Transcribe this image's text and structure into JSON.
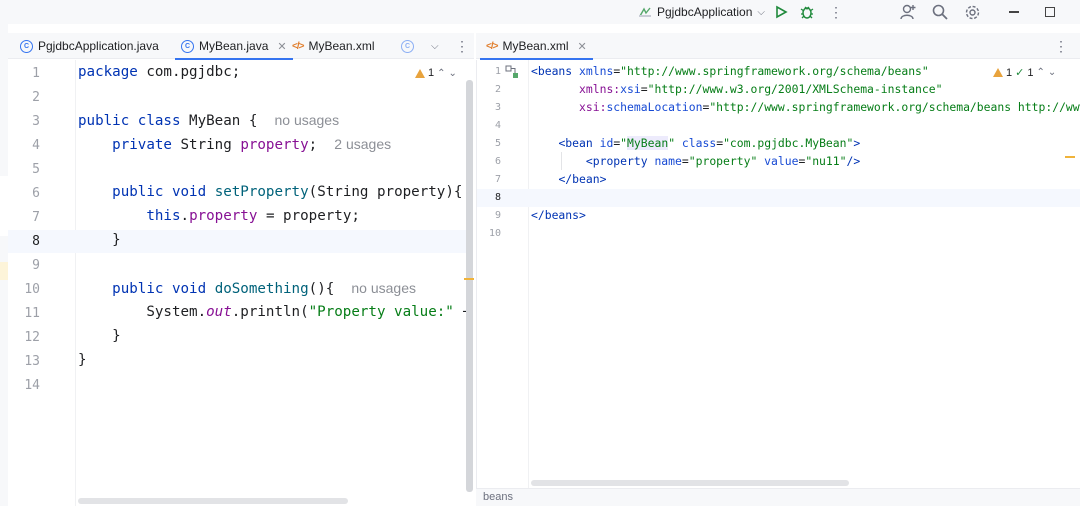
{
  "toolbar": {
    "run_config": "PgjdbcApplication",
    "icons": [
      "run-icon",
      "debug-icon",
      "more-icon",
      "add-user-icon",
      "search-icon",
      "settings-icon",
      "minimize-icon",
      "maximize-icon"
    ]
  },
  "left_pane": {
    "tabs": [
      {
        "label": "PgjdbcApplication.java",
        "icon": "java-class-icon"
      },
      {
        "label": "MyBean.java",
        "icon": "java-class-icon",
        "active": true
      },
      {
        "label": "MyBean.xml",
        "icon": "xml-file-icon"
      }
    ],
    "inspection": {
      "warnings": "1"
    },
    "lines": {
      "l1": {
        "kw": "package",
        "rest": " com.pgjdbc;"
      },
      "l3": {
        "kw1": "public",
        "kw2": "class",
        "name": " MyBean {",
        "hint": "no usages"
      },
      "l4": {
        "kw": "private",
        "type": " String ",
        "field": "property",
        "semi": ";",
        "hint": "2 usages"
      },
      "l6": {
        "kw1": "public",
        "kw2": "void",
        "method": "setProperty",
        "rest": "(String property){"
      },
      "l7": {
        "kw": "this",
        "dot": ".",
        "field": "property",
        "rest": " = property;"
      },
      "l8": "}",
      "l10": {
        "kw1": "public",
        "kw2": "void",
        "method": "doSomething",
        "rest": "(){",
        "hint": "no usages"
      },
      "l11": {
        "pre": "System.",
        "out": "out",
        "mid": ".println(",
        "str": "\"Property value:\"",
        "post": " +"
      },
      "l12": "}",
      "l13": "}"
    },
    "line_numbers": [
      "1",
      "2",
      "3",
      "4",
      "5",
      "6",
      "7",
      "8",
      "9",
      "10",
      "11",
      "12",
      "13",
      "14"
    ]
  },
  "right_pane": {
    "tab": {
      "label": "MyBean.xml",
      "icon": "xml-file-icon"
    },
    "inspection": {
      "warnings": "1",
      "ok": "1"
    },
    "line_numbers": [
      "1",
      "2",
      "3",
      "4",
      "5",
      "6",
      "7",
      "8",
      "9",
      "10"
    ],
    "xml": {
      "l1": {
        "open": "<beans ",
        "a": "xmlns",
        "eq": "=",
        "v": "\"http://www.springframework.org/schema/beans\""
      },
      "l2": {
        "ns": "xmlns:",
        "a": "xsi",
        "eq": "=",
        "v": "\"http://www.w3.org/2001/XMLSchema-instance\""
      },
      "l3": {
        "ns": "xsi:",
        "a": "schemaLocation",
        "eq": "=",
        "v": "\"http://www.springframework.org/schema/beans http://www.s"
      },
      "l5": {
        "open": "<bean ",
        "a1": "id",
        "eq1": "=",
        "q1": "\"",
        "id": "MyBean",
        "q2": "\"",
        "a2": " class",
        "eq2": "=",
        "v2": "\"com.pgjdbc.MyBean\"",
        "close": ">"
      },
      "l6": {
        "open": "<property ",
        "a1": "name",
        "eq1": "=",
        "v1": "\"property\"",
        "a2": " value",
        "eq2": "=",
        "v2": "\"nu11\"",
        "close": "/>"
      },
      "l7": "</bean>",
      "l9": "</beans>"
    },
    "breadcrumb": "beans"
  }
}
